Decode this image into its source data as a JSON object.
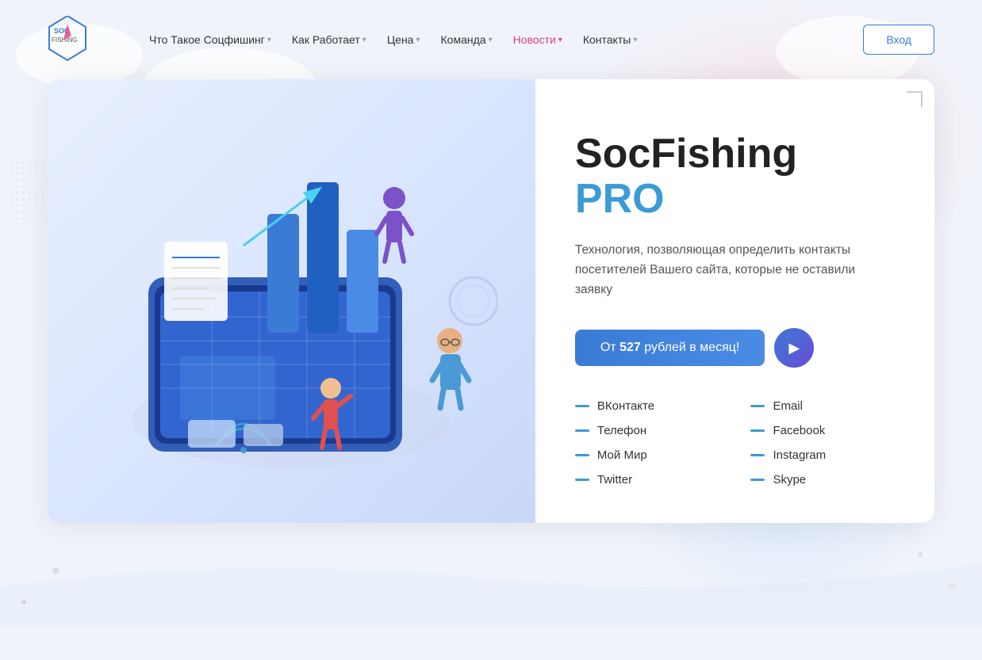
{
  "nav": {
    "logo_text": "SOC FISHING",
    "items": [
      {
        "label": "Что Такое Соцфишинг",
        "has_arrow": true,
        "active": false
      },
      {
        "label": "Как Работает",
        "has_arrow": true,
        "active": false
      },
      {
        "label": "Цена",
        "has_arrow": true,
        "active": false
      },
      {
        "label": "Команда",
        "has_arrow": true,
        "active": false
      },
      {
        "label": "Новости",
        "has_arrow": true,
        "active": true
      },
      {
        "label": "Контакты",
        "has_arrow": true,
        "active": false
      }
    ],
    "login_label": "Вход"
  },
  "hero": {
    "title_main": "SocFishing ",
    "title_accent": "PRO",
    "description": "Технология, позволяющая определить контакты посетителей Вашего сайта, которые не оставили заявку",
    "cta_prefix": "От ",
    "cta_price": "527",
    "cta_suffix": " рублей в месяц!",
    "play_button_label": "▶"
  },
  "contacts": {
    "left": [
      {
        "label": "ВКонтакте"
      },
      {
        "label": "Телефон"
      },
      {
        "label": "Мой Мир"
      },
      {
        "label": "Twitter"
      }
    ],
    "right": [
      {
        "label": "Email"
      },
      {
        "label": "Facebook"
      },
      {
        "label": "Instagram"
      },
      {
        "label": "Skype"
      }
    ]
  },
  "colors": {
    "accent_blue": "#3a9bd5",
    "accent_pink": "#e04080",
    "nav_active": "#e04080",
    "btn_border": "#3a7bd5"
  }
}
